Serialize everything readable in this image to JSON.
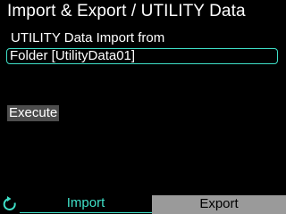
{
  "header": {
    "title": "Import & Export / UTILITY Data"
  },
  "main": {
    "import_label": "UTILITY Data Import from",
    "source_value": "Folder [UtilityData01]",
    "execute_label": "Execute"
  },
  "footer": {
    "back_icon": "refresh-back-icon",
    "tabs": [
      {
        "label": "Import",
        "selected": true
      },
      {
        "label": "Export",
        "selected": false
      }
    ]
  },
  "colors": {
    "background": "#000000",
    "accent": "#3fe0c8",
    "button": "#4d4d4d",
    "inactive_tab": "#9a9a9a",
    "text": "#ffffff"
  }
}
